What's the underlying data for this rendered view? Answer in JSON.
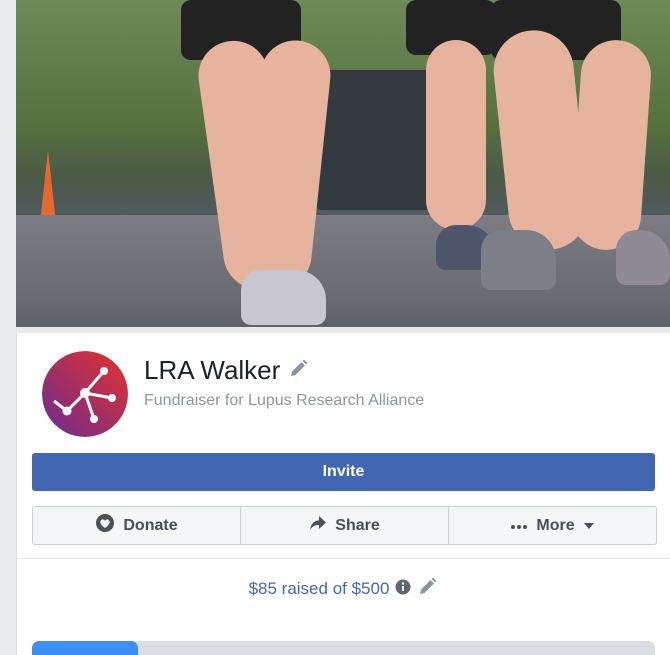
{
  "fundraiser": {
    "name": "LRA Walker",
    "subtitle": "Fundraiser for Lupus Research Alliance"
  },
  "buttons": {
    "invite": "Invite",
    "donate": "Donate",
    "share": "Share",
    "more": "More"
  },
  "progress": {
    "raised_text": "$85 raised of $500",
    "raised": 85,
    "goal": 500
  },
  "icons": {
    "edit": "pencil-icon",
    "info": "info-icon",
    "donate": "donate-heart-icon",
    "share": "share-arrow-icon",
    "more": "ellipsis-icon",
    "caret": "caret-down-icon"
  },
  "colors": {
    "primary": "#4267b2",
    "progress_fill": "#3b8ff5",
    "progress_track": "#dadde1",
    "logo_red": "#e5322d",
    "logo_purple": "#6a2c91"
  }
}
